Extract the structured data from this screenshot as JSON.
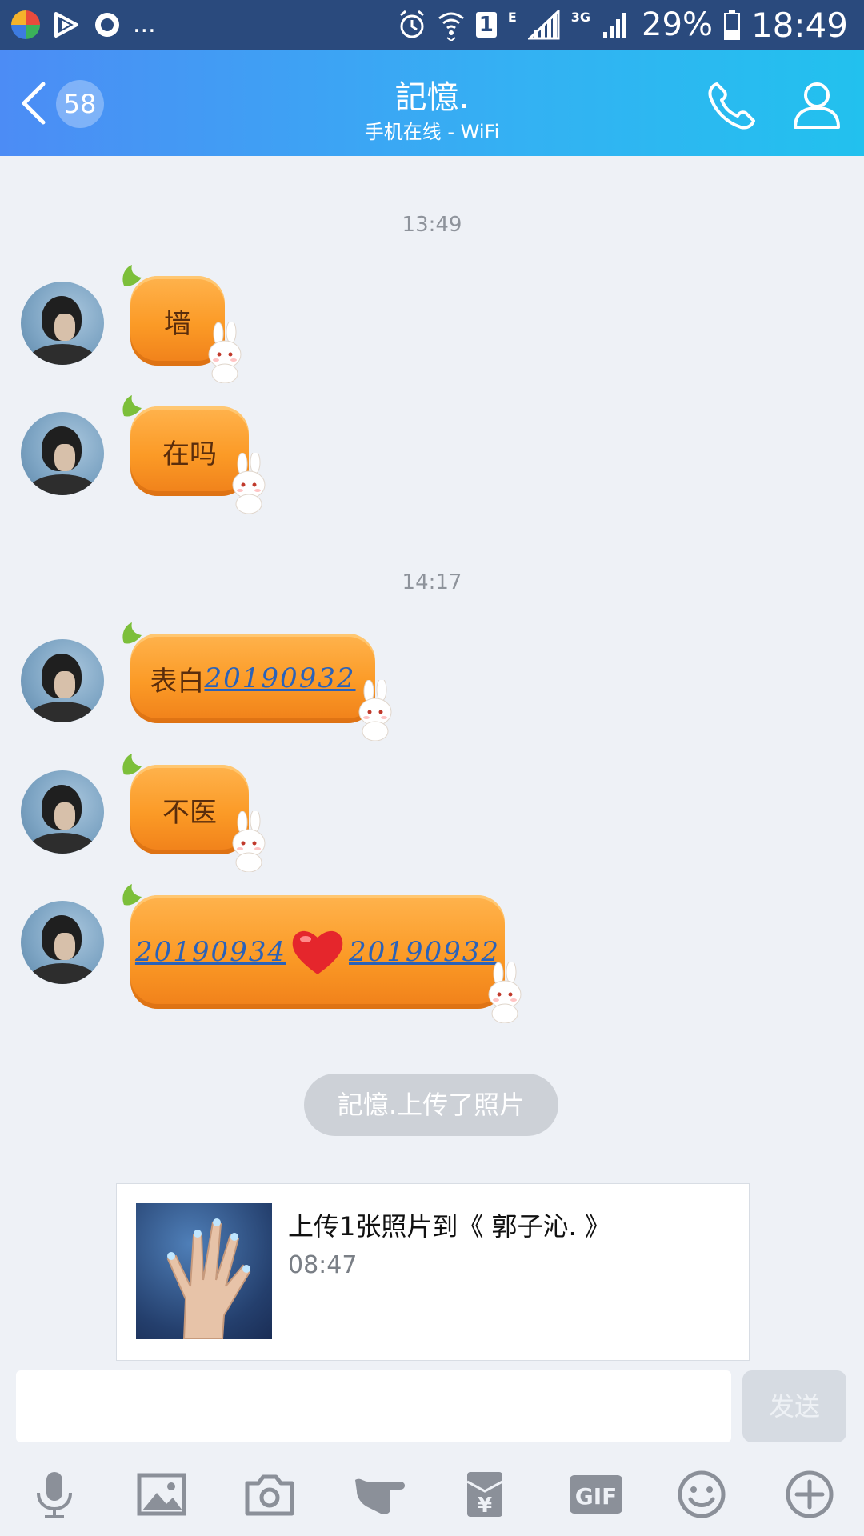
{
  "status_bar": {
    "battery": "29%",
    "time": "18:49",
    "sim": "1",
    "network_e": "E",
    "network_3g": "3G",
    "more": "...",
    "app_icons": [
      "colorful-ball-icon",
      "video-play-icon",
      "qq-browser-icon"
    ]
  },
  "header": {
    "unread_count": "58",
    "title": "記憶.",
    "subtitle": "手机在线 - WiFi",
    "icons": [
      "back-arrow-icon",
      "phone-call-icon",
      "profile-icon"
    ]
  },
  "chat": {
    "timestamps": [
      "13:49",
      "14:17"
    ],
    "messages": [
      {
        "text": "墙"
      },
      {
        "text": "在吗"
      },
      {
        "text_prefix": "表白",
        "number": "20190932"
      },
      {
        "text": "不医"
      },
      {
        "number_left": "20190934",
        "number_right": "20190932",
        "emoji": "heart-icon"
      }
    ],
    "system_notice": "記憶.上传了照片",
    "photo_card": {
      "title": "上传1张照片到《 郭子沁. 》",
      "time": "08:47"
    }
  },
  "input": {
    "value": "",
    "send_label": "发送"
  },
  "toolbar": {
    "items": [
      "microphone-icon",
      "image-icon",
      "camera-icon",
      "poke-icon",
      "red-packet-icon",
      "gif-icon",
      "emoji-icon",
      "plus-icon"
    ],
    "gif_label": "GIF",
    "red_packet_label": "¥"
  },
  "colors": {
    "header_start": "#4c8cf5",
    "header_end": "#22c1ee",
    "bubble": "#fb9a26",
    "link": "#2a62b9",
    "background": "#eef1f6"
  }
}
